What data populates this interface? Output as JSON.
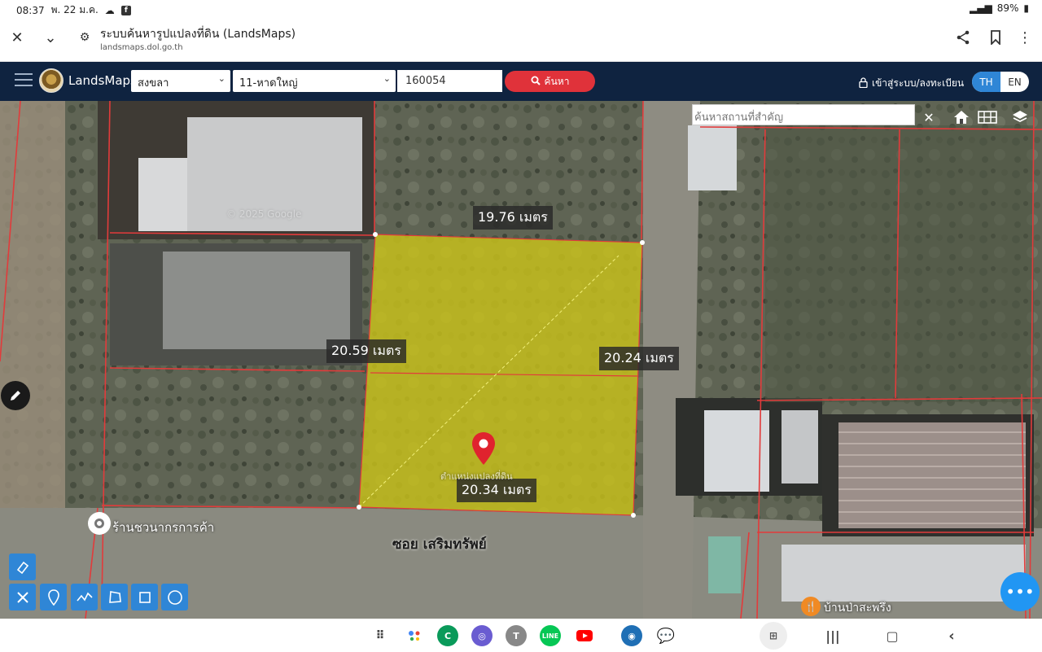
{
  "status": {
    "time": "08:37",
    "date": "พ. 22 ม.ค.",
    "battery": "89%"
  },
  "browser": {
    "title": "ระบบค้นหารูปแปลงที่ดิน (LandsMaps)",
    "url": "landsmaps.dol.go.th"
  },
  "header": {
    "brand": "LandsMaps",
    "province": "สงขลา",
    "district": "11-หาดใหญ่",
    "parcel_number": "160054",
    "search_label": "ค้นหา",
    "login_label": "เข้าสู่ระบบ/ลงทะเบียน",
    "lang_th": "TH",
    "lang_en": "EN"
  },
  "map": {
    "place_search_placeholder": "ค้นหาสถานที่สำคัญ",
    "measurements": {
      "top": "19.76 เมตร",
      "left": "20.59 เมตร",
      "right": "20.24 เมตร",
      "bottom": "20.34 เมตร"
    },
    "marker_label": "ตำแหน่งแปลงที่ดิน",
    "poi_shop": "ร้านชวนากรการค้า",
    "road_name": "ซอย เสริมทรัพย์",
    "poi_restaurant": "บ้านป่าสะพรึง",
    "watermark": "© 2025 Google",
    "colors": {
      "parcel_fill": "#c9c21a",
      "parcel_line": "#e23b3b",
      "header_bg": "#0f2340",
      "accent": "#2f86d6"
    }
  }
}
